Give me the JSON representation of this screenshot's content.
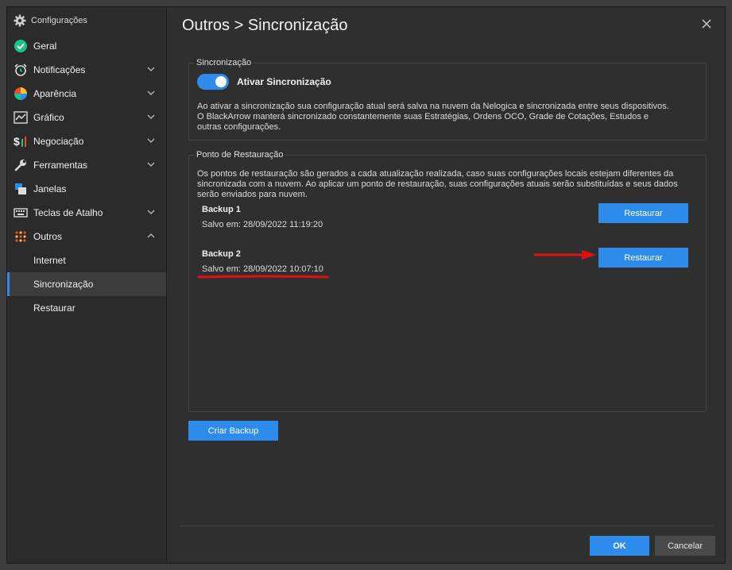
{
  "sidebar": {
    "header": "Configurações",
    "items": [
      {
        "label": "Geral",
        "icon": "check-circle-icon",
        "expandable": false
      },
      {
        "label": "Notificações",
        "icon": "alarm-clock-icon",
        "expandable": true
      },
      {
        "label": "Aparência",
        "icon": "palette-icon",
        "expandable": true
      },
      {
        "label": "Gráfico",
        "icon": "chart-icon",
        "expandable": true
      },
      {
        "label": "Negociação",
        "icon": "dollar-chart-icon",
        "expandable": true
      },
      {
        "label": "Ferramentas",
        "icon": "wrench-icon",
        "expandable": true
      },
      {
        "label": "Janelas",
        "icon": "windows-icon",
        "expandable": false
      },
      {
        "label": "Teclas de Atalho",
        "icon": "keyboard-icon",
        "expandable": true
      },
      {
        "label": "Outros",
        "icon": "grid-dots-icon",
        "expandable": true,
        "expanded": true
      }
    ],
    "subitems": [
      {
        "label": "Internet"
      },
      {
        "label": "Sincronização",
        "active": true
      },
      {
        "label": "Restaurar"
      }
    ]
  },
  "main": {
    "title": "Outros > Sincronização",
    "sync": {
      "legend": "Sincronização",
      "toggle_label": "Ativar Sincronização",
      "toggle_on": true,
      "description": "Ao ativar a sincronização sua configuração atual será salva na nuvem da Nelogica e sincronizada entre seus dispositivos. O BlackArrow manterá sincronizado constantemente suas Estratégias, Ordens OCO, Grade de Cotações, Estudos e outras configurações."
    },
    "restore": {
      "legend": "Ponto de Restauração",
      "description": "Os pontos de restauração são gerados a cada atualização realizada, caso suas configurações locais estejam diferentes da sincronizada com a nuvem. Ao aplicar um ponto de restauração, suas configurações atuais serão substituídas e seus dados serão enviados para nuvem.",
      "backups": [
        {
          "title": "Backup 1",
          "date": "Salvo em: 28/09/2022 11:19:20",
          "button": "Restaurar"
        },
        {
          "title": "Backup 2",
          "date": "Salvo em: 28/09/2022 10:07:10",
          "button": "Restaurar"
        }
      ]
    },
    "create_backup": "Criar Backup"
  },
  "footer": {
    "ok": "OK",
    "cancel": "Cancelar"
  },
  "colors": {
    "accent": "#2d8ceb",
    "annotation": "#e01010"
  }
}
